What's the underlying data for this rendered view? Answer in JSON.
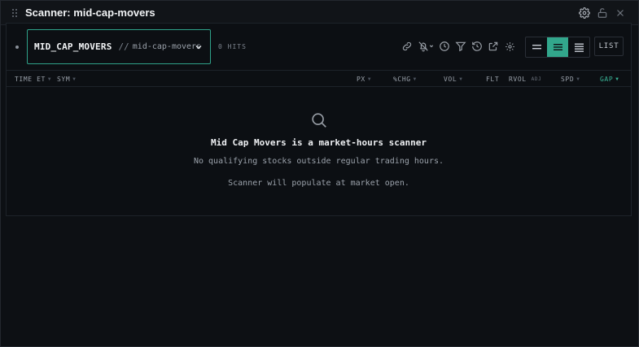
{
  "window": {
    "title": "Scanner: mid-cap-movers"
  },
  "title_icons": [
    "gear-icon",
    "lock-icon",
    "close-icon"
  ],
  "toolbar": {
    "scanner_id": "MID_CAP_MOVERS",
    "separator": "//",
    "scanner_slug": "mid-cap-movers",
    "hits": "0 HITS",
    "icons": [
      "link-icon",
      "bell-off-icon",
      "clock-icon",
      "filter-icon",
      "history-icon",
      "external-link-icon",
      "settings-icon"
    ],
    "view_modes": [
      "compact",
      "normal",
      "expanded"
    ],
    "active_view": "normal",
    "list_label": "LIST"
  },
  "columns": {
    "time": "TIME ET",
    "sym": "SYM",
    "px": "PX",
    "chg": "%CHG",
    "vol": "VOL",
    "flt": "FLT",
    "rvol": "RVOL",
    "rvol_tag": "ADJ",
    "spd": "SPD",
    "gap": "GAP",
    "sorted_by": "GAP"
  },
  "empty_state": {
    "title": "Mid Cap Movers is a market-hours scanner",
    "line1": "No qualifying stocks outside regular trading hours.",
    "line2": "Scanner will populate at market open."
  },
  "colors": {
    "accent": "#32a78c",
    "background": "#0d1014"
  }
}
